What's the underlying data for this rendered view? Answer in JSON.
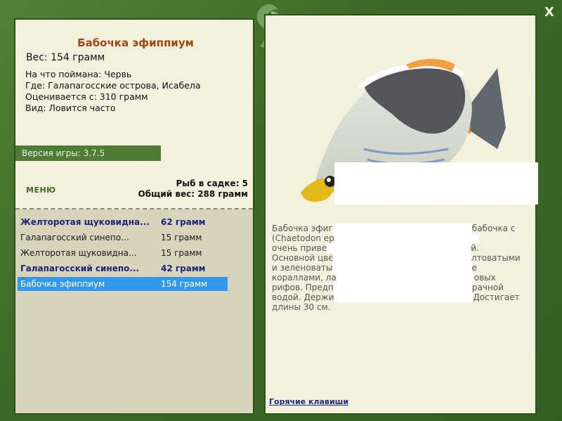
{
  "fish": {
    "title": "Бабочка эфиппиум",
    "weight": "Вес: 154 грамм",
    "bait": "На что поймана: Червь",
    "location": "Где: Галапагосские острова, Исабела",
    "value_from": "Оценивается с: 310 грамм",
    "frequency": "Вид: Ловится часто"
  },
  "version": "Версия игры: 3.7.5",
  "menu_label": "МЕНЮ",
  "cage": {
    "count": "Рыб в садке: 5",
    "total": "Общий вес: 288 грамм"
  },
  "catch_list": [
    {
      "name": "Желторотая щуковидна...",
      "weight": "62 грамм",
      "bold": true
    },
    {
      "name": "Галапагосский синепо...",
      "weight": "15 грамм",
      "bold": false
    },
    {
      "name": "Желторотая щуковидна...",
      "weight": "15 грамм",
      "bold": false
    },
    {
      "name": "Галапагосский синепо...",
      "weight": "42 грамм",
      "bold": true
    },
    {
      "name": "Бабочка эфиппиум",
      "weight": "154 грамм",
      "bold": false,
      "selected": true
    }
  ],
  "description": [
    {
      "left": "Бабочка эфиг",
      "right": "бабочка с"
    },
    {
      "left": "(Chaetodon ep",
      "right": ""
    },
    {
      "left": "очень приве",
      "right": "й."
    },
    {
      "left": "Основной цвє",
      "right": "лтоватыми"
    },
    {
      "left": "и зеленоваты",
      "right": "е"
    },
    {
      "left": "кораллами, ла",
      "right": "овых"
    },
    {
      "left": "рифов. Предп",
      "right": "рачной"
    },
    {
      "left": "водой. Держи",
      "right": "Достигает"
    },
    {
      "left": "длины 30 см.",
      "right": ""
    }
  ],
  "hotkeys_label": "Горячие клавиши",
  "close_label": "X",
  "colors": {
    "frame": "#3f6a28",
    "panel": "#f3f1dd",
    "title": "#a3440f",
    "selected": "#3399ee"
  }
}
